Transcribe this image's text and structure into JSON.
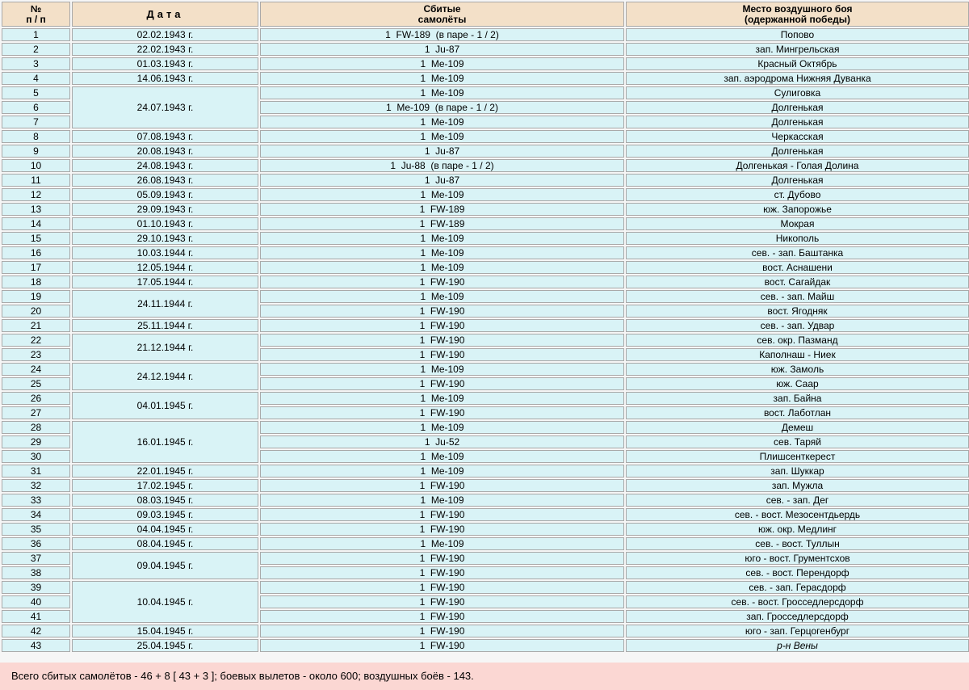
{
  "headers": {
    "num_line1": "№",
    "num_line2": "п / п",
    "date": "Дата",
    "planes_line1": "Сбитые",
    "planes_line2": "самолёты",
    "place_line1": "Место воздушного боя",
    "place_line2": "(одержанной победы)"
  },
  "rows": [
    {
      "n": "1",
      "date": "02.02.1943 г.",
      "plane": "1  FW-189  (в паре - 1 / 2)",
      "place": "Попово"
    },
    {
      "n": "2",
      "date": "22.02.1943 г.",
      "plane": "1  Ju-87",
      "place": "зап. Мингрельская"
    },
    {
      "n": "3",
      "date": "01.03.1943 г.",
      "plane": "1  Me-109",
      "place": "Красный Октябрь"
    },
    {
      "n": "4",
      "date": "14.06.1943 г.",
      "plane": "1  Me-109",
      "place": "зап. аэродрома Нижняя Дуванка"
    },
    {
      "n": "5",
      "date": "24.07.1943 г.",
      "span": 3,
      "plane": "1  Me-109",
      "place": "Сулиговка"
    },
    {
      "n": "6",
      "plane": "1  Me-109  (в паре - 1 / 2)",
      "place": "Долгенькая"
    },
    {
      "n": "7",
      "plane": "1  Me-109",
      "place": "Долгенькая"
    },
    {
      "n": "8",
      "date": "07.08.1943 г.",
      "plane": "1  Me-109",
      "place": "Черкасская"
    },
    {
      "n": "9",
      "date": "20.08.1943 г.",
      "plane": "1  Ju-87",
      "place": "Долгенькая"
    },
    {
      "n": "10",
      "date": "24.08.1943 г.",
      "plane": "1  Ju-88  (в паре - 1 / 2)",
      "place": "Долгенькая - Голая Долина"
    },
    {
      "n": "11",
      "date": "26.08.1943 г.",
      "plane": "1  Ju-87",
      "place": "Долгенькая"
    },
    {
      "n": "12",
      "date": "05.09.1943 г.",
      "plane": "1  Me-109",
      "place": "ст. Дубово"
    },
    {
      "n": "13",
      "date": "29.09.1943 г.",
      "plane": "1  FW-189",
      "place": "юж. Запорожье"
    },
    {
      "n": "14",
      "date": "01.10.1943 г.",
      "plane": "1  FW-189",
      "place": "Мокрая"
    },
    {
      "n": "15",
      "date": "29.10.1943 г.",
      "plane": "1  Me-109",
      "place": "Никополь"
    },
    {
      "n": "16",
      "date": "10.03.1944 г.",
      "plane": "1  Me-109",
      "place": "сев. - зап. Баштанка"
    },
    {
      "n": "17",
      "date": "12.05.1944 г.",
      "plane": "1  Me-109",
      "place": "вост. Аснашени"
    },
    {
      "n": "18",
      "date": "17.05.1944 г.",
      "plane": "1  FW-190",
      "place": "вост. Сагайдак"
    },
    {
      "n": "19",
      "date": "24.11.1944 г.",
      "span": 2,
      "plane": "1  Me-109",
      "place": "сев. - зап. Майш"
    },
    {
      "n": "20",
      "plane": "1  FW-190",
      "place": "вост. Ягодняк"
    },
    {
      "n": "21",
      "date": "25.11.1944 г.",
      "plane": "1  FW-190",
      "place": "сев. - зап. Удвар"
    },
    {
      "n": "22",
      "date": "21.12.1944 г.",
      "span": 2,
      "plane": "1  FW-190",
      "place": "сев. окр. Пазманд"
    },
    {
      "n": "23",
      "plane": "1  FW-190",
      "place": "Каполнаш - Ниек"
    },
    {
      "n": "24",
      "date": "24.12.1944 г.",
      "span": 2,
      "plane": "1  Me-109",
      "place": "юж. Замоль"
    },
    {
      "n": "25",
      "plane": "1  FW-190",
      "place": "юж. Саар"
    },
    {
      "n": "26",
      "date": "04.01.1945 г.",
      "span": 2,
      "plane": "1  Me-109",
      "place": "зап. Байна"
    },
    {
      "n": "27",
      "plane": "1  FW-190",
      "place": "вост. Лаботлан"
    },
    {
      "n": "28",
      "date": "16.01.1945 г.",
      "span": 3,
      "plane": "1  Me-109",
      "place": "Демеш"
    },
    {
      "n": "29",
      "plane": "1  Ju-52",
      "place": "сев. Таряй"
    },
    {
      "n": "30",
      "plane": "1  Me-109",
      "place": "Плишсенткерест"
    },
    {
      "n": "31",
      "date": "22.01.1945 г.",
      "plane": "1  Me-109",
      "place": "зап. Шуккар"
    },
    {
      "n": "32",
      "date": "17.02.1945 г.",
      "plane": "1  FW-190",
      "place": "зап. Мужла"
    },
    {
      "n": "33",
      "date": "08.03.1945 г.",
      "plane": "1  Me-109",
      "place": "сев. - зап. Дег"
    },
    {
      "n": "34",
      "date": "09.03.1945 г.",
      "plane": "1  FW-190",
      "place": "сев. - вост. Мезосентдьердь"
    },
    {
      "n": "35",
      "date": "04.04.1945 г.",
      "plane": "1  FW-190",
      "place": "юж. окр. Медлинг"
    },
    {
      "n": "36",
      "date": "08.04.1945 г.",
      "plane": "1  Me-109",
      "place": "сев. - вост. Туллын"
    },
    {
      "n": "37",
      "date": "09.04.1945 г.",
      "span": 2,
      "plane": "1  FW-190",
      "place": "юго - вост. Грументсхов"
    },
    {
      "n": "38",
      "plane": "1  FW-190",
      "place": "сев. - вост. Перендорф"
    },
    {
      "n": "39",
      "date": "10.04.1945 г.",
      "span": 3,
      "plane": "1  FW-190",
      "place": "сев. - зап. Герасдорф"
    },
    {
      "n": "40",
      "plane": "1  FW-190",
      "place": "сев. - вост. Гросседлерсдорф"
    },
    {
      "n": "41",
      "plane": "1  FW-190",
      "place": "зап. Гросседлерсдорф"
    },
    {
      "n": "42",
      "date": "15.04.1945 г.",
      "plane": "1  FW-190",
      "place": "юго - зап. Герцогенбург"
    },
    {
      "n": "43",
      "date": "25.04.1945 г.",
      "plane": "1  FW-190",
      "place": "р-н Вены",
      "italic": true
    }
  ],
  "summary": "Всего сбитых самолётов - 46 + 8  [ 43 + 3 ];  боевых вылетов - около 600;  воздушных боёв - 143.",
  "colors": {
    "header_bg": "#f3e0c8",
    "cell_bg": "#d9f3f6",
    "summary_bg": "#fbd7d3",
    "border": "#a9a9a9"
  }
}
